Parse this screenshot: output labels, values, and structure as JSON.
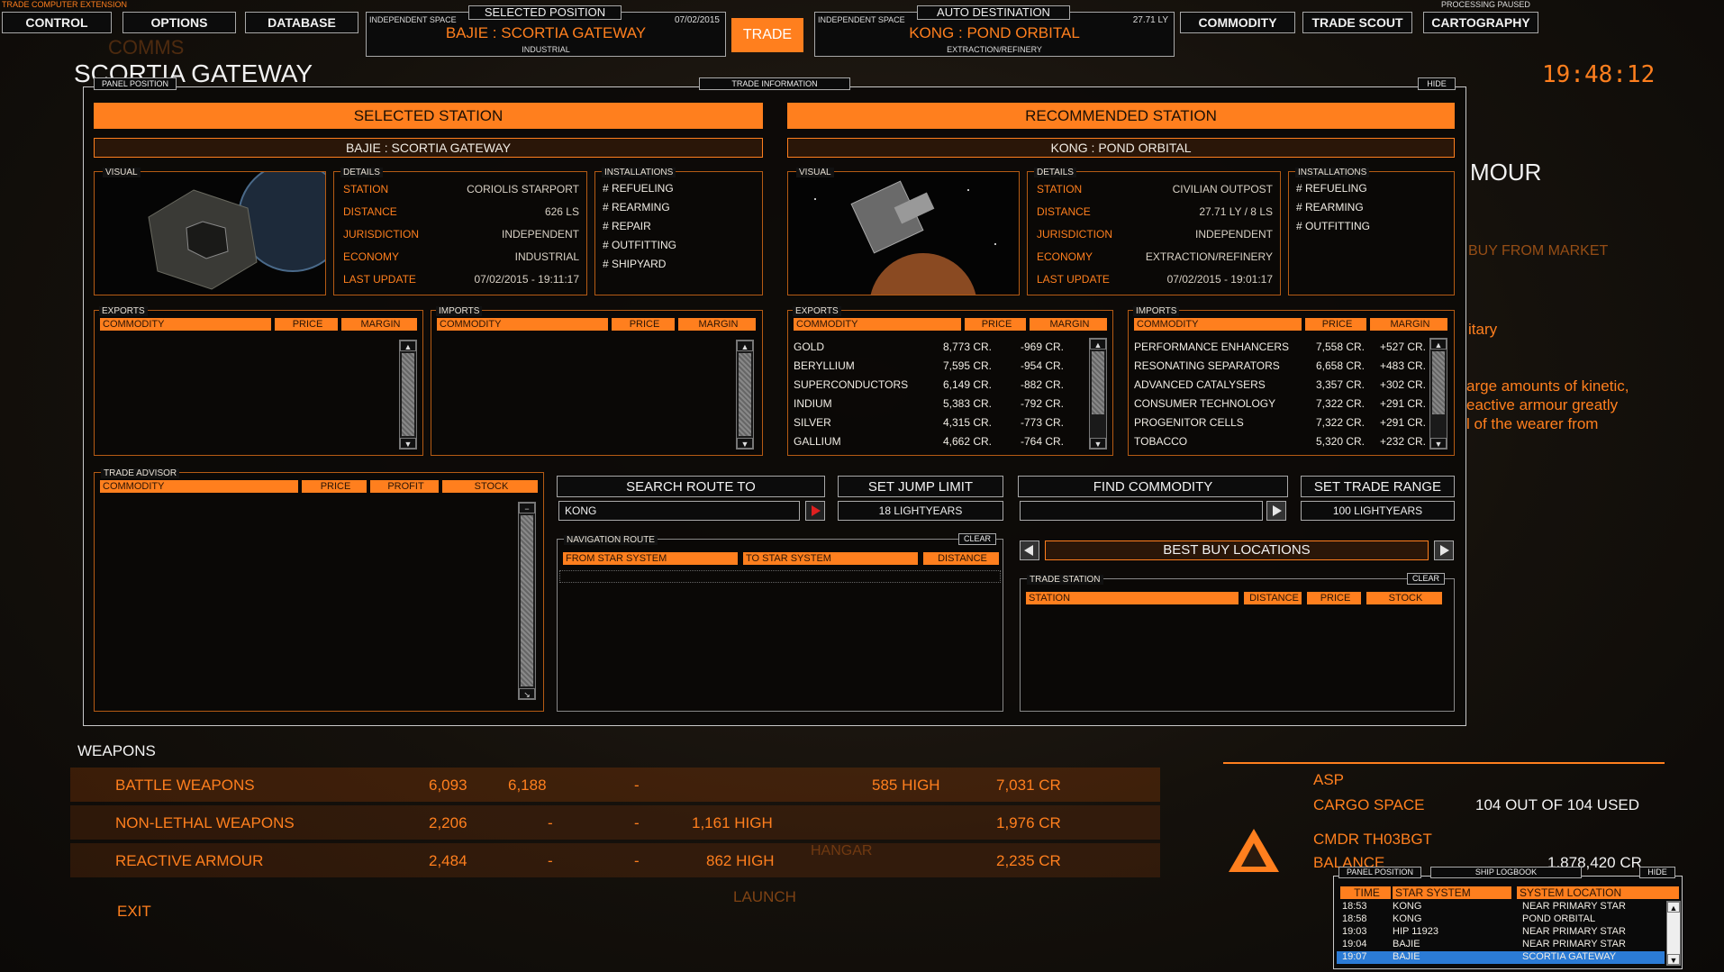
{
  "top": {
    "ext_label": "TRADE COMPUTER EXTENSION",
    "processing": "PROCESSING PAUSED",
    "left_buttons": [
      "CONTROL",
      "OPTIONS",
      "DATABASE"
    ],
    "right_buttons": [
      "COMMODITY",
      "TRADE SCOUT",
      "CARTOGRAPHY"
    ],
    "trade_button": "TRADE",
    "selected": {
      "space": "INDEPENDENT SPACE",
      "tab": "SELECTED POSITION",
      "date": "07/02/2015",
      "name": "BAJIE : SCORTIA GATEWAY",
      "type": "INDUSTRIAL"
    },
    "auto": {
      "space": "INDEPENDENT SPACE",
      "tab": "AUTO DESTINATION",
      "dist": "27.71 LY",
      "name": "KONG : POND ORBITAL",
      "type": "EXTRACTION/REFINERY"
    }
  },
  "background": {
    "station_title": "SCORTIA GATEWAY",
    "clock": "19:48:12",
    "comms": "COMMS",
    "right_title": "MOUR",
    "right_buy": "BUY FROM MARKET",
    "right_text1": "itary",
    "right_text2": [
      "arge amounts of kinetic,",
      "eactive armour greatly",
      "l of the wearer from"
    ],
    "weapons_title": "WEAPONS",
    "weapons": [
      {
        "name": "BATTLE WEAPONS",
        "a": "6,093",
        "b": "6,188",
        "c": "-",
        "d": "",
        "e": "585 HIGH",
        "f": "7,031 CR"
      },
      {
        "name": "NON-LETHAL WEAPONS",
        "a": "2,206",
        "b": "-",
        "c": "-",
        "d": "1,161 HIGH",
        "e": "",
        "f": "1,976 CR"
      },
      {
        "name": "REACTIVE ARMOUR",
        "a": "2,484",
        "b": "-",
        "c": "-",
        "d": "862 HIGH",
        "e": "",
        "f": "2,235 CR"
      }
    ],
    "ship": "ASP",
    "cargo_label": "CARGO SPACE",
    "cargo_value": "104 OUT OF 104 USED",
    "cmdr": "CMDR TH03BGT",
    "balance_label": "BALANCE",
    "balance_value": "1,878,420 CR",
    "exit": "EXIT",
    "launch": "LAUNCH",
    "hangar": "HANGAR"
  },
  "panel": {
    "position_tab": "PANEL POSITION",
    "info_tab": "TRADE INFORMATION",
    "hide": "HIDE",
    "selected": {
      "header": "SELECTED STATION",
      "name": "BAJIE : SCORTIA GATEWAY",
      "visual": "VISUAL",
      "details_label": "DETAILS",
      "details": [
        {
          "k": "STATION",
          "v": "CORIOLIS STARPORT"
        },
        {
          "k": "DISTANCE",
          "v": "626 LS"
        },
        {
          "k": "JURISDICTION",
          "v": "INDEPENDENT"
        },
        {
          "k": "ECONOMY",
          "v": "INDUSTRIAL"
        },
        {
          "k": "LAST UPDATE",
          "v": "07/02/2015 - 19:11:17"
        }
      ],
      "installations_label": "INSTALLATIONS",
      "installations": [
        "# REFUELING",
        "# REARMING",
        "# REPAIR",
        "# OUTFITTING",
        "# SHIPYARD"
      ],
      "exports_label": "EXPORTS",
      "imports_label": "IMPORTS"
    },
    "recommended": {
      "header": "RECOMMENDED STATION",
      "name": "KONG : POND ORBITAL",
      "visual": "VISUAL",
      "details_label": "DETAILS",
      "details": [
        {
          "k": "STATION",
          "v": "CIVILIAN OUTPOST"
        },
        {
          "k": "DISTANCE",
          "v": "27.71 LY / 8 LS"
        },
        {
          "k": "JURISDICTION",
          "v": "INDEPENDENT"
        },
        {
          "k": "ECONOMY",
          "v": "EXTRACTION/REFINERY"
        },
        {
          "k": "LAST UPDATE",
          "v": "07/02/2015 - 19:01:17"
        }
      ],
      "installations_label": "INSTALLATIONS",
      "installations": [
        "# REFUELING",
        "# REARMING",
        "# OUTFITTING"
      ],
      "exports_label": "EXPORTS",
      "imports_label": "IMPORTS",
      "exports": [
        {
          "c": "GOLD",
          "p": "8,773 CR.",
          "m": "-969 CR."
        },
        {
          "c": "BERYLLIUM",
          "p": "7,595 CR.",
          "m": "-954 CR."
        },
        {
          "c": "SUPERCONDUCTORS",
          "p": "6,149 CR.",
          "m": "-882 CR."
        },
        {
          "c": "INDIUM",
          "p": "5,383 CR.",
          "m": "-792 CR."
        },
        {
          "c": "SILVER",
          "p": "4,315 CR.",
          "m": "-773 CR."
        },
        {
          "c": "GALLIUM",
          "p": "4,662 CR.",
          "m": "-764 CR."
        }
      ],
      "imports": [
        {
          "c": "PERFORMANCE ENHANCERS",
          "p": "7,558 CR.",
          "m": "+527 CR."
        },
        {
          "c": "RESONATING SEPARATORS",
          "p": "6,658 CR.",
          "m": "+483 CR."
        },
        {
          "c": "ADVANCED CATALYSERS",
          "p": "3,357 CR.",
          "m": "+302 CR."
        },
        {
          "c": "CONSUMER TECHNOLOGY",
          "p": "7,322 CR.",
          "m": "+291 CR."
        },
        {
          "c": "PROGENITOR CELLS",
          "p": "7,322 CR.",
          "m": "+291 CR."
        },
        {
          "c": "TOBACCO",
          "p": "5,320 CR.",
          "m": "+232 CR."
        }
      ]
    },
    "cols": {
      "commodity": "COMMODITY",
      "price": "PRICE",
      "margin": "MARGIN",
      "profit": "PROFIT",
      "stock": "STOCK"
    },
    "advisor_label": "TRADE ADVISOR",
    "search_route": {
      "button": "SEARCH ROUTE TO",
      "value": "KONG"
    },
    "jump_limit": {
      "button": "SET JUMP LIMIT",
      "value": "18 LIGHTYEARS"
    },
    "find_commodity": {
      "button": "FIND COMMODITY",
      "value": ""
    },
    "trade_range": {
      "button": "SET TRADE RANGE",
      "value": "100 LIGHTYEARS"
    },
    "nav": {
      "label": "NAVIGATION ROUTE",
      "clear": "CLEAR",
      "from": "FROM STAR SYSTEM",
      "to": "TO STAR SYSTEM",
      "distance": "DISTANCE"
    },
    "best": {
      "title": "BEST BUY LOCATIONS",
      "label": "TRADE STATION",
      "clear": "CLEAR",
      "station": "STATION",
      "distance": "DISTANCE",
      "price": "PRICE",
      "stock": "STOCK"
    }
  },
  "logbook": {
    "position_tab": "PANEL POSITION",
    "title": "SHIP LOGBOOK",
    "hide": "HIDE",
    "cols": [
      "TIME",
      "STAR SYSTEM",
      "SYSTEM LOCATION"
    ],
    "rows": [
      {
        "t": "18:53",
        "s": "KONG",
        "l": "NEAR PRIMARY STAR"
      },
      {
        "t": "18:58",
        "s": "KONG",
        "l": "POND ORBITAL"
      },
      {
        "t": "19:03",
        "s": "HIP 11923",
        "l": "NEAR PRIMARY STAR"
      },
      {
        "t": "19:04",
        "s": "BAJIE",
        "l": "NEAR PRIMARY STAR"
      },
      {
        "t": "19:07",
        "s": "BAJIE",
        "l": "SCORTIA GATEWAY"
      }
    ]
  }
}
